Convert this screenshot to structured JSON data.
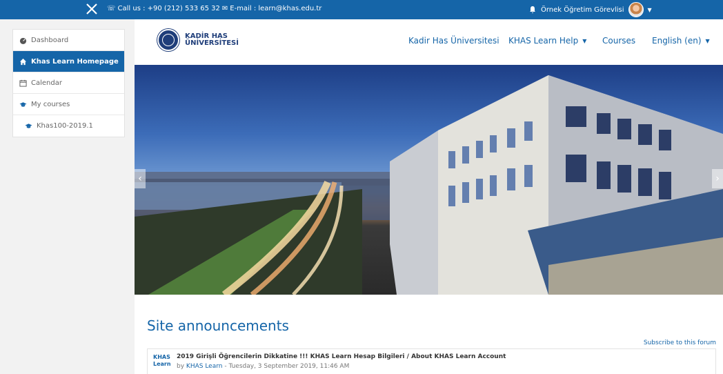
{
  "topbar": {
    "contact_phone": "Call us : +90 (212) 533 65 32",
    "contact_email": "E-mail : learn@khas.edu.tr",
    "user_name": "Örnek Öğretim Görevlisi"
  },
  "sidebar": {
    "items": [
      {
        "label": "Dashboard",
        "icon": "dashboard-icon"
      },
      {
        "label": "Khas Learn Homepage",
        "icon": "home-icon",
        "active": true
      },
      {
        "label": "Calendar",
        "icon": "calendar-icon"
      },
      {
        "label": "My courses",
        "icon": "graduation-cap-icon"
      },
      {
        "label": "Khas100-2019.1",
        "icon": "graduation-cap-icon"
      }
    ]
  },
  "header": {
    "logo_line1": "KADİR HAS",
    "logo_line2": "ÜNİVERSİTESİ",
    "nav": {
      "university": "Kadir Has Üniversitesi",
      "help": "KHAS Learn Help",
      "courses": "Courses",
      "language": "English (en)"
    }
  },
  "content": {
    "heading": "Site announcements",
    "subscribe": "Subscribe to this forum",
    "post": {
      "avatar_line1": "KHAS",
      "avatar_line2": "Learn",
      "title": "2019 Girişli Öğrencilerin Dikkatine !!! KHAS Learn Hesap Bilgileri / About KHAS Learn Account",
      "by": "by",
      "author": "KHAS Learn",
      "date": "- Tuesday, 3 September 2019, 11:46 AM"
    }
  },
  "colors": {
    "brand_blue": "#1565a8",
    "navy": "#1f3e7a"
  }
}
